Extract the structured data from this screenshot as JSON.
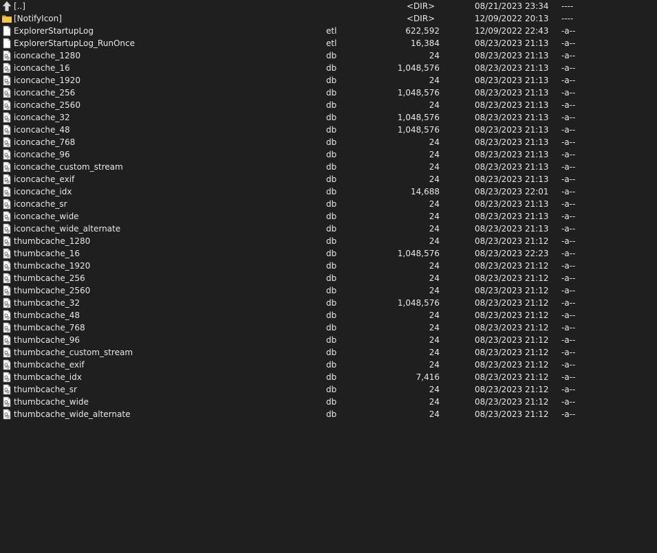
{
  "file_list": {
    "rows": [
      {
        "icon": "up-arrow-icon",
        "name": "[..]",
        "ext": "",
        "size": "<DIR>",
        "date": "08/21/2023 23:34",
        "attr": "----"
      },
      {
        "icon": "folder-icon",
        "name": "[NotifyIcon]",
        "ext": "",
        "size": "<DIR>",
        "date": "12/09/2022 20:13",
        "attr": "----"
      },
      {
        "icon": "file-icon",
        "name": "ExplorerStartupLog",
        "ext": "etl",
        "size": "622,592",
        "date": "12/09/2022 22:43",
        "attr": "-a--"
      },
      {
        "icon": "file-icon",
        "name": "ExplorerStartupLog_RunOnce",
        "ext": "etl",
        "size": "16,384",
        "date": "08/23/2023 21:13",
        "attr": "-a--"
      },
      {
        "icon": "db-file-icon",
        "name": "iconcache_1280",
        "ext": "db",
        "size": "24",
        "date": "08/23/2023 21:13",
        "attr": "-a--"
      },
      {
        "icon": "db-file-icon",
        "name": "iconcache_16",
        "ext": "db",
        "size": "1,048,576",
        "date": "08/23/2023 21:13",
        "attr": "-a--"
      },
      {
        "icon": "db-file-icon",
        "name": "iconcache_1920",
        "ext": "db",
        "size": "24",
        "date": "08/23/2023 21:13",
        "attr": "-a--"
      },
      {
        "icon": "db-file-icon",
        "name": "iconcache_256",
        "ext": "db",
        "size": "1,048,576",
        "date": "08/23/2023 21:13",
        "attr": "-a--"
      },
      {
        "icon": "db-file-icon",
        "name": "iconcache_2560",
        "ext": "db",
        "size": "24",
        "date": "08/23/2023 21:13",
        "attr": "-a--"
      },
      {
        "icon": "db-file-icon",
        "name": "iconcache_32",
        "ext": "db",
        "size": "1,048,576",
        "date": "08/23/2023 21:13",
        "attr": "-a--"
      },
      {
        "icon": "db-file-icon",
        "name": "iconcache_48",
        "ext": "db",
        "size": "1,048,576",
        "date": "08/23/2023 21:13",
        "attr": "-a--"
      },
      {
        "icon": "db-file-icon",
        "name": "iconcache_768",
        "ext": "db",
        "size": "24",
        "date": "08/23/2023 21:13",
        "attr": "-a--"
      },
      {
        "icon": "db-file-icon",
        "name": "iconcache_96",
        "ext": "db",
        "size": "24",
        "date": "08/23/2023 21:13",
        "attr": "-a--"
      },
      {
        "icon": "db-file-icon",
        "name": "iconcache_custom_stream",
        "ext": "db",
        "size": "24",
        "date": "08/23/2023 21:13",
        "attr": "-a--"
      },
      {
        "icon": "db-file-icon",
        "name": "iconcache_exif",
        "ext": "db",
        "size": "24",
        "date": "08/23/2023 21:13",
        "attr": "-a--"
      },
      {
        "icon": "db-file-icon",
        "name": "iconcache_idx",
        "ext": "db",
        "size": "14,688",
        "date": "08/23/2023 22:01",
        "attr": "-a--"
      },
      {
        "icon": "db-file-icon",
        "name": "iconcache_sr",
        "ext": "db",
        "size": "24",
        "date": "08/23/2023 21:13",
        "attr": "-a--"
      },
      {
        "icon": "db-file-icon",
        "name": "iconcache_wide",
        "ext": "db",
        "size": "24",
        "date": "08/23/2023 21:13",
        "attr": "-a--"
      },
      {
        "icon": "db-file-icon",
        "name": "iconcache_wide_alternate",
        "ext": "db",
        "size": "24",
        "date": "08/23/2023 21:13",
        "attr": "-a--"
      },
      {
        "icon": "db-file-icon",
        "name": "thumbcache_1280",
        "ext": "db",
        "size": "24",
        "date": "08/23/2023 21:12",
        "attr": "-a--"
      },
      {
        "icon": "db-file-icon",
        "name": "thumbcache_16",
        "ext": "db",
        "size": "1,048,576",
        "date": "08/23/2023 22:23",
        "attr": "-a--"
      },
      {
        "icon": "db-file-icon",
        "name": "thumbcache_1920",
        "ext": "db",
        "size": "24",
        "date": "08/23/2023 21:12",
        "attr": "-a--"
      },
      {
        "icon": "db-file-icon",
        "name": "thumbcache_256",
        "ext": "db",
        "size": "24",
        "date": "08/23/2023 21:12",
        "attr": "-a--"
      },
      {
        "icon": "db-file-icon",
        "name": "thumbcache_2560",
        "ext": "db",
        "size": "24",
        "date": "08/23/2023 21:12",
        "attr": "-a--"
      },
      {
        "icon": "db-file-icon",
        "name": "thumbcache_32",
        "ext": "db",
        "size": "1,048,576",
        "date": "08/23/2023 21:12",
        "attr": "-a--"
      },
      {
        "icon": "db-file-icon",
        "name": "thumbcache_48",
        "ext": "db",
        "size": "24",
        "date": "08/23/2023 21:12",
        "attr": "-a--"
      },
      {
        "icon": "db-file-icon",
        "name": "thumbcache_768",
        "ext": "db",
        "size": "24",
        "date": "08/23/2023 21:12",
        "attr": "-a--"
      },
      {
        "icon": "db-file-icon",
        "name": "thumbcache_96",
        "ext": "db",
        "size": "24",
        "date": "08/23/2023 21:12",
        "attr": "-a--"
      },
      {
        "icon": "db-file-icon",
        "name": "thumbcache_custom_stream",
        "ext": "db",
        "size": "24",
        "date": "08/23/2023 21:12",
        "attr": "-a--"
      },
      {
        "icon": "db-file-icon",
        "name": "thumbcache_exif",
        "ext": "db",
        "size": "24",
        "date": "08/23/2023 21:12",
        "attr": "-a--"
      },
      {
        "icon": "db-file-icon",
        "name": "thumbcache_idx",
        "ext": "db",
        "size": "7,416",
        "date": "08/23/2023 21:12",
        "attr": "-a--"
      },
      {
        "icon": "db-file-icon",
        "name": "thumbcache_sr",
        "ext": "db",
        "size": "24",
        "date": "08/23/2023 21:12",
        "attr": "-a--"
      },
      {
        "icon": "db-file-icon",
        "name": "thumbcache_wide",
        "ext": "db",
        "size": "24",
        "date": "08/23/2023 21:12",
        "attr": "-a--"
      },
      {
        "icon": "db-file-icon",
        "name": "thumbcache_wide_alternate",
        "ext": "db",
        "size": "24",
        "date": "08/23/2023 21:12",
        "attr": "-a--"
      }
    ]
  },
  "colors": {
    "background": "#1f1f1f",
    "text": "#e6e6e6",
    "folder": "#f2c54b"
  }
}
